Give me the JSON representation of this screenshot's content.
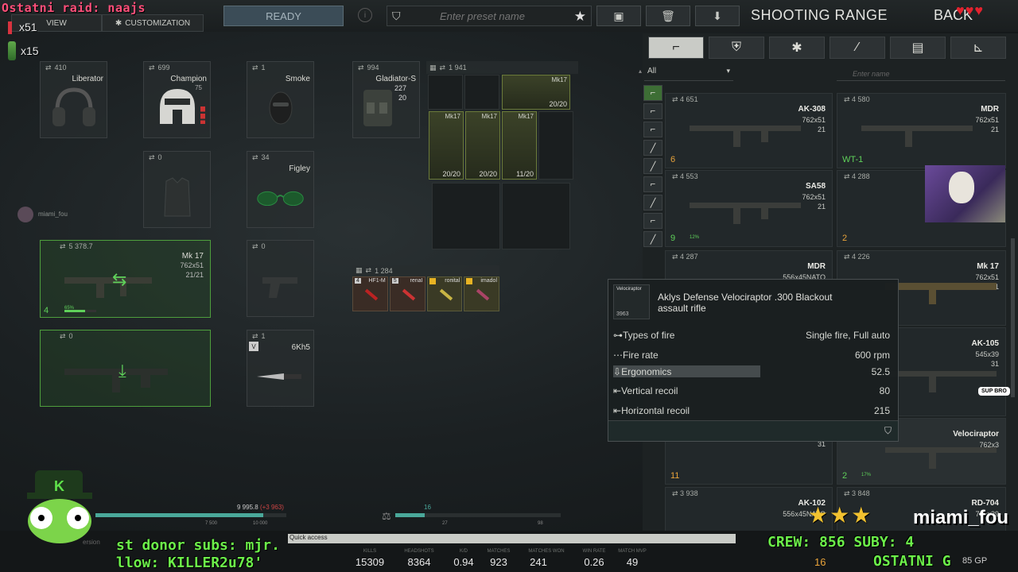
{
  "overlay": {
    "raid_text": "Ostatni raid: naajs",
    "hearts": "♥♥♥",
    "counter_x51": "x51",
    "counter_x15": "x15",
    "donor_text": "st donor subs: mjr.",
    "follow_text": "llow: KILLER2u78'",
    "crew_text": "CREW: 856 SUBY: 4",
    "ostatni_text": "OSTATNI G",
    "streamer_name": "miami_fou",
    "sup_bro": "SUP BRO",
    "stars": "★★★",
    "avatar_label": "miami_fou"
  },
  "header": {
    "overview_tab": "VIEW",
    "customization_tab": "CUSTOMIZATION",
    "ready_button": "READY",
    "preset_placeholder": "Enter preset name",
    "title": "SHOOTING RANGE",
    "back_button": "BACK"
  },
  "equipment": {
    "headwear": {
      "price": "410",
      "name": "Liberator"
    },
    "helmet": {
      "price": "699",
      "name": "Champion",
      "sub": "75"
    },
    "facecover": {
      "price": "1",
      "name": "Smoke"
    },
    "armband": {
      "price": "0"
    },
    "eyewear": {
      "price": "34",
      "name": "Figley"
    },
    "rig": {
      "price": "994",
      "name": "Gladiator-S",
      "durability": "227",
      "cap": "20"
    },
    "backpack": {
      "price": "1 941"
    },
    "primary": {
      "price": "5 378.7",
      "name": "Mk 17",
      "caliber": "762x51",
      "ammo": "21/21",
      "level": "4",
      "pct": "65%"
    },
    "secondary": {
      "price": "0"
    },
    "pistol": {
      "price": "0"
    },
    "melee": {
      "price": "1",
      "name": "6Kh5",
      "badge": "V"
    },
    "pockets": {
      "price": "1 284",
      "items": [
        {
          "n": "4",
          "lbl": "HF1-M"
        },
        {
          "n": "5",
          "lbl": "renaI"
        },
        {
          "n": "",
          "lbl": "rопital"
        },
        {
          "n": "",
          "lbl": "imadol"
        }
      ]
    }
  },
  "mags": [
    {
      "lbl": "Mk17",
      "cnt": "20/20"
    },
    {
      "lbl": "Mk17",
      "cnt": "20/20"
    },
    {
      "lbl": "Mk17",
      "cnt": "20/20"
    },
    {
      "lbl": "Mk17",
      "cnt": "11/20"
    }
  ],
  "bars": {
    "xp_value": "9 995.8",
    "xp_delta": "(+3 963)",
    "xp_min": "7 500",
    "xp_max": "10 000",
    "lvl_value": "16",
    "lvl_min": "27",
    "lvl_max": "98"
  },
  "store": {
    "filter": "All",
    "search_placeholder": "Enter name",
    "cards": [
      {
        "price": "4 651",
        "name": "AK-308",
        "cal": "762x51",
        "cnt": "21",
        "lv": "6"
      },
      {
        "price": "4 580",
        "name": "MDR",
        "cal": "762x51",
        "cnt": "21",
        "lv": "WT-1"
      },
      {
        "price": "4 553",
        "name": "SA58",
        "cal": "762x51",
        "cnt": "21",
        "lv": "9",
        "pct": "12%"
      },
      {
        "price": "4 288",
        "name": "",
        "cal": "",
        "cnt": "",
        "lv": "2"
      },
      {
        "price": "4 287",
        "name": "MDR",
        "cal": "556x45NATO",
        "cnt": "",
        "lv": ""
      },
      {
        "price": "4 226",
        "name": "Mk 17",
        "cal": "762x51",
        "cnt": "21",
        "lv": ""
      },
      {
        "price": "",
        "name": "",
        "cal": "",
        "cnt": "31",
        "lv": "11"
      },
      {
        "price": "",
        "name": "AK-105",
        "cal": "545x39",
        "cnt": "31",
        "lv": ""
      },
      {
        "price": "",
        "name": "Velociraptor",
        "cal": "762x3",
        "cnt": "",
        "lv": "2",
        "pct": "17%"
      },
      {
        "price": "3 938",
        "name": "AK-102",
        "cal": "556x45NATO",
        "cnt": "",
        "lv": ""
      },
      {
        "price": "3 848",
        "name": "RD-704",
        "cal": "762x39",
        "cnt": "",
        "lv": ""
      }
    ]
  },
  "tooltip": {
    "short": "Velociraptor",
    "id": "3963",
    "title": "Aklys Defense Velociraptor .300 Blackout assault rifle",
    "rows": [
      {
        "k": "Types of fire",
        "v": "Single fire, Full auto"
      },
      {
        "k": "Fire rate",
        "v": "600 rpm"
      },
      {
        "k": "Ergonomics",
        "v": "52.5"
      },
      {
        "k": "Vertical recoil",
        "v": "80"
      },
      {
        "k": "Horizontal recoil",
        "v": "215"
      }
    ]
  },
  "stats": {
    "quick_access": "Quick access",
    "version": "ersion",
    "kills_label": "KILLS",
    "kills": "15309",
    "headshots_label": "HEADSHOTS",
    "headshots": "8364",
    "kd_label": "K/D",
    "kd": "0.94",
    "matches_label": "MATCHES",
    "matches": "923",
    "won_label": "MATCHES WON",
    "won": "241",
    "winrate_label": "WIN RATE",
    "winrate": "0.26",
    "mvp_label": "MATCH MVP",
    "mvp": "49",
    "bp": "16",
    "gp": "85 GP"
  }
}
